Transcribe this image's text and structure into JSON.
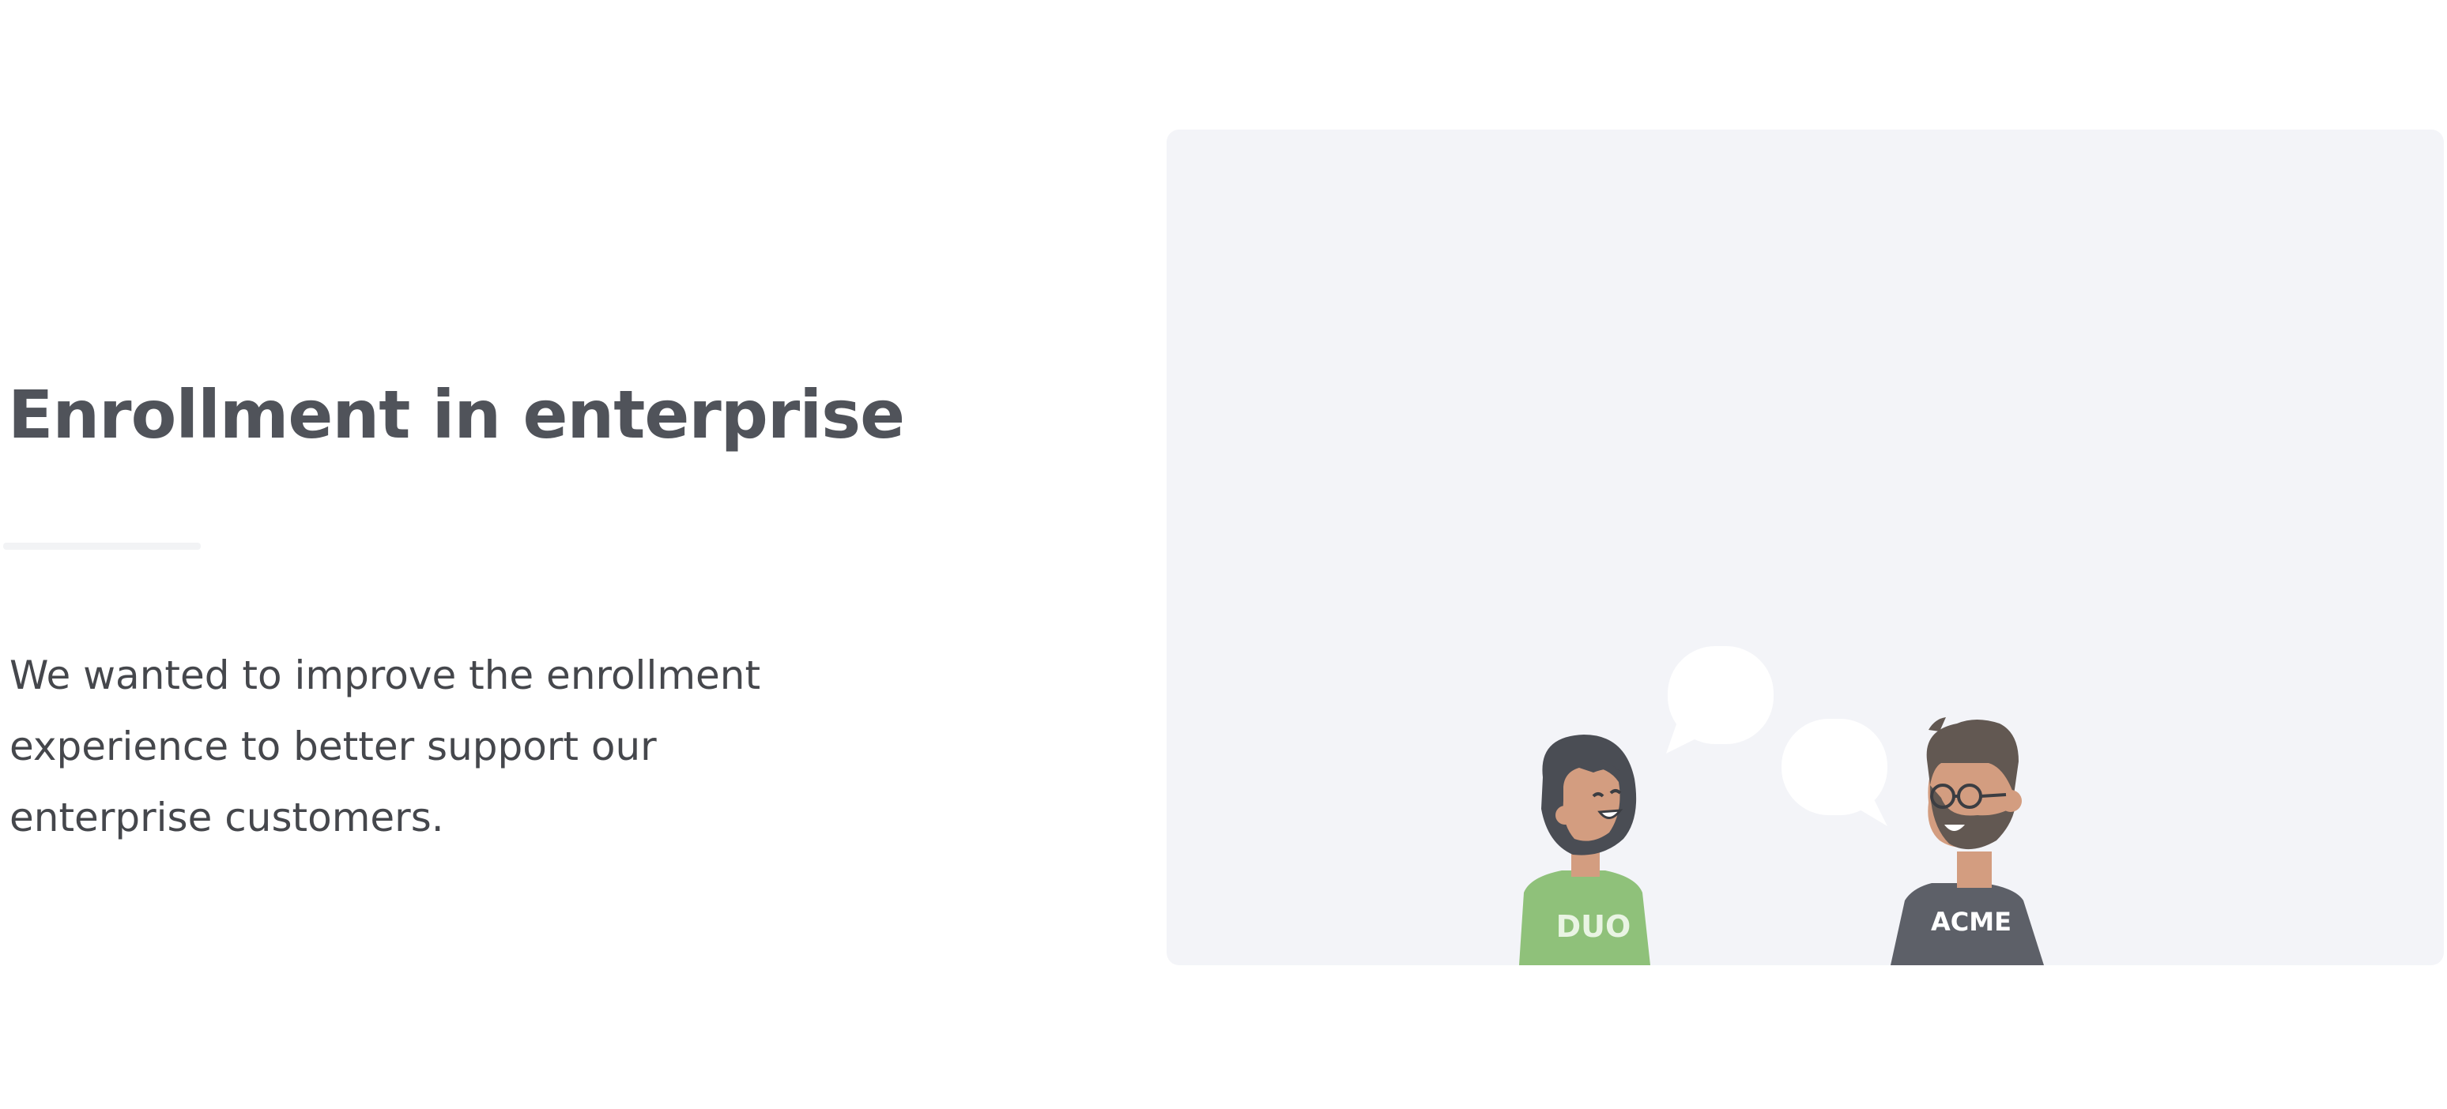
{
  "section": {
    "headline": "Enrollment in enterprise",
    "body_lines": [
      "We wanted to improve the enrollment",
      "experience to better support our",
      "enterprise customers."
    ]
  },
  "illustration": {
    "left_shirt_text": "DUO",
    "right_shirt_text": "ACME",
    "colors": {
      "card_background": "#f3f4f8",
      "left_shirt": "#8fc17a",
      "right_shirt": "#5d6068",
      "hair_dark": "#4a4d54",
      "hair_brown": "#625852",
      "skin": "#d39d80",
      "speech_bubble": "#ffffff"
    }
  }
}
